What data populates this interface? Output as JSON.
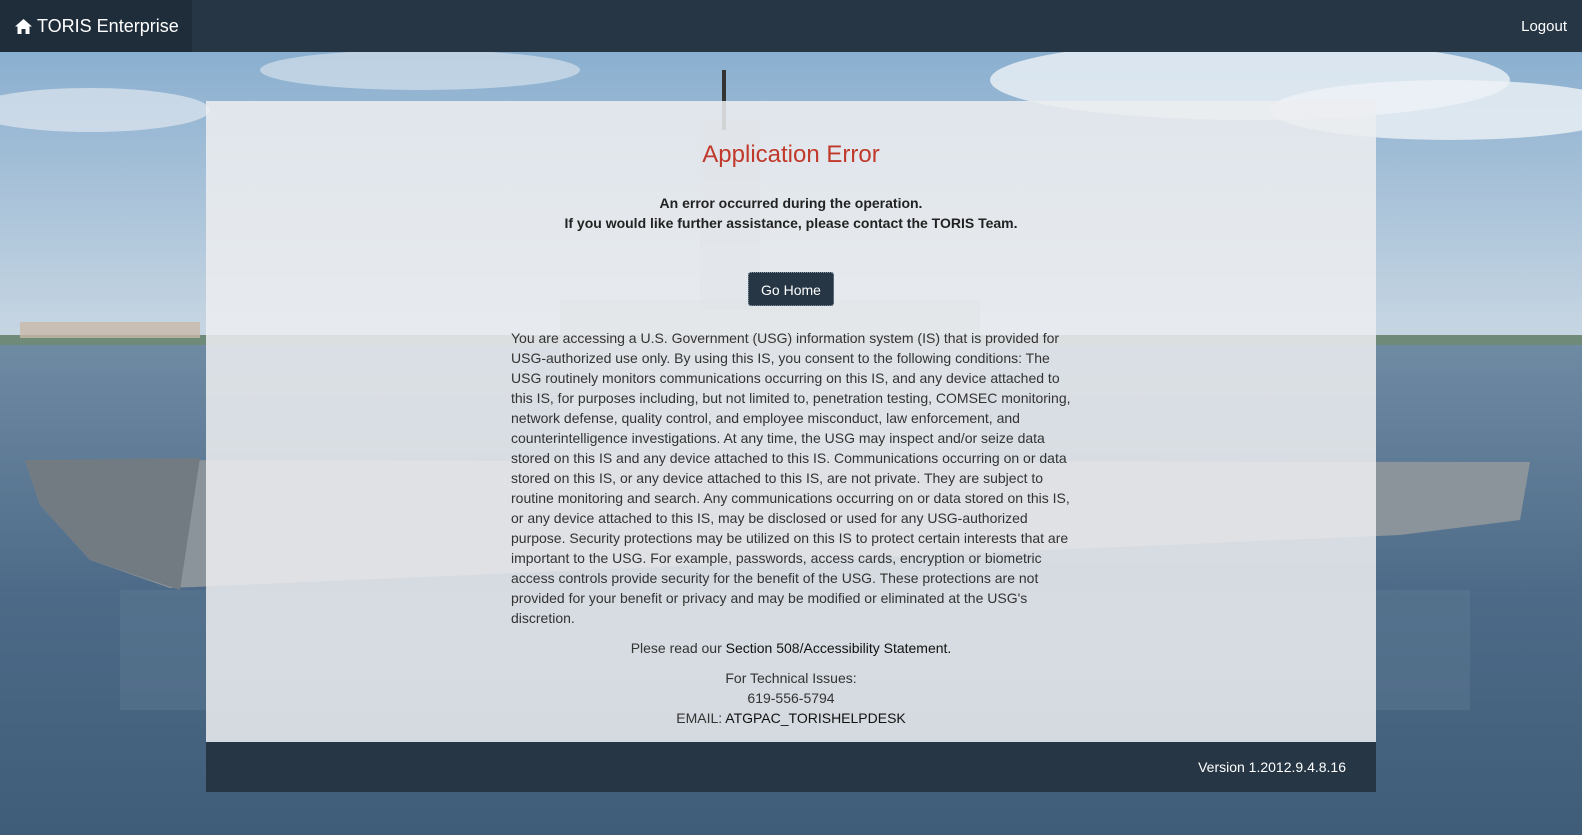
{
  "navbar": {
    "brand_label": "TORIS Enterprise",
    "brand_icon": "home-icon",
    "logout_label": "Logout"
  },
  "error": {
    "title": "Application Error",
    "line1": "An error occurred during the operation.",
    "line2": "If you would like further assistance, please contact the TORIS Team.",
    "go_home_label": "Go Home"
  },
  "notice": {
    "text": "You are accessing a U.S. Government (USG) information system (IS) that is provided for USG-authorized use only. By using this IS, you consent to the following conditions: The USG routinely monitors communications occurring on this IS, and any device attached to this IS, for purposes including, but not limited to, penetration testing, COMSEC monitoring, network defense, quality control, and employee misconduct, law enforcement, and counterintelligence investigations. At any time, the USG may inspect and/or seize data stored on this IS and any device attached to this IS. Communications occurring on or data stored on this IS, or any device attached to this IS, are not private. They are subject to routine monitoring and search. Any communications occurring on or data stored on this IS, or any device attached to this IS, may be disclosed or used for any USG-authorized purpose. Security protections may be utilized on this IS to protect certain interests that are important to the USG. For example, passwords, access cards, encryption or biometric access controls provide security for the benefit of the USG. These protections are not provided for your benefit or privacy and may be modified or eliminated at the USG's discretion."
  },
  "accessibility": {
    "prefix": "Plese read our",
    "link_label": "Section 508/Accessibility Statement."
  },
  "tech": {
    "heading": "For Technical Issues:",
    "phone": "619-556-5794",
    "email_prefix": "EMAIL:",
    "email_link": "ATGPAC_TORISHELPDESK"
  },
  "footer": {
    "version": "Version 1.2012.9.4.8.16"
  },
  "colors": {
    "navbar": "#263645",
    "title_red": "#c0392b",
    "panel": "#eceef0"
  }
}
